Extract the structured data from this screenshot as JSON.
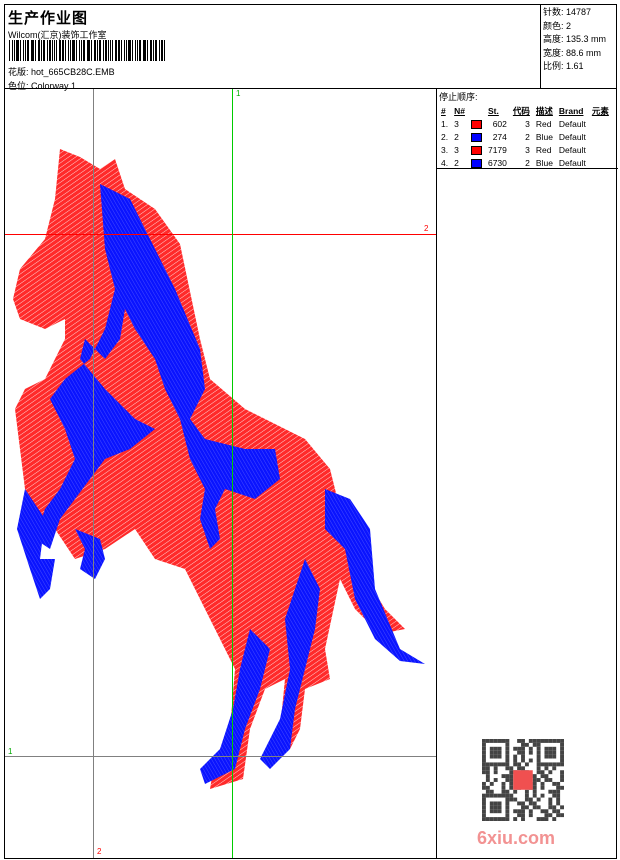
{
  "header": {
    "title": "生产作业图",
    "studio": "Wilcom(汇京)装饰工作室",
    "design_label": "花版:",
    "design_value": "hot_665CB28C.EMB",
    "colorway_label": "色位:",
    "colorway_value": "Colorway 1"
  },
  "info": {
    "stitches": "针数: 14787",
    "colors": "颜色: 2",
    "height": "高度: 135.3 mm",
    "width": "宽度: 88.6 mm",
    "scale": "比例: 1.61"
  },
  "stop_sequence": {
    "title": "停止顺序:",
    "columns": [
      "#",
      "N#",
      "",
      "St.",
      "代码",
      "描述",
      "Brand",
      "元素"
    ],
    "rows": [
      {
        "idx": "1.",
        "n": "3",
        "color": "#ff0000",
        "st": "602",
        "code": "3",
        "desc": "Red",
        "brand": "Default"
      },
      {
        "idx": "2.",
        "n": "2",
        "color": "#0000ff",
        "st": "274",
        "code": "2",
        "desc": "Blue",
        "brand": "Default"
      },
      {
        "idx": "3.",
        "n": "3",
        "color": "#ff0000",
        "st": "7179",
        "code": "3",
        "desc": "Red",
        "brand": "Default"
      },
      {
        "idx": "4.",
        "n": "2",
        "color": "#0000ff",
        "st": "6730",
        "code": "2",
        "desc": "Blue",
        "brand": "Default"
      }
    ]
  },
  "guides": {
    "green_top": "1",
    "red_right": "2",
    "gray_left": "1",
    "gray_bottom": "2"
  },
  "watermark": "6xiu.com",
  "colors": {
    "red": "#ff0000",
    "blue": "#0000ff",
    "green": "#00cc00",
    "gray": "#808080"
  }
}
